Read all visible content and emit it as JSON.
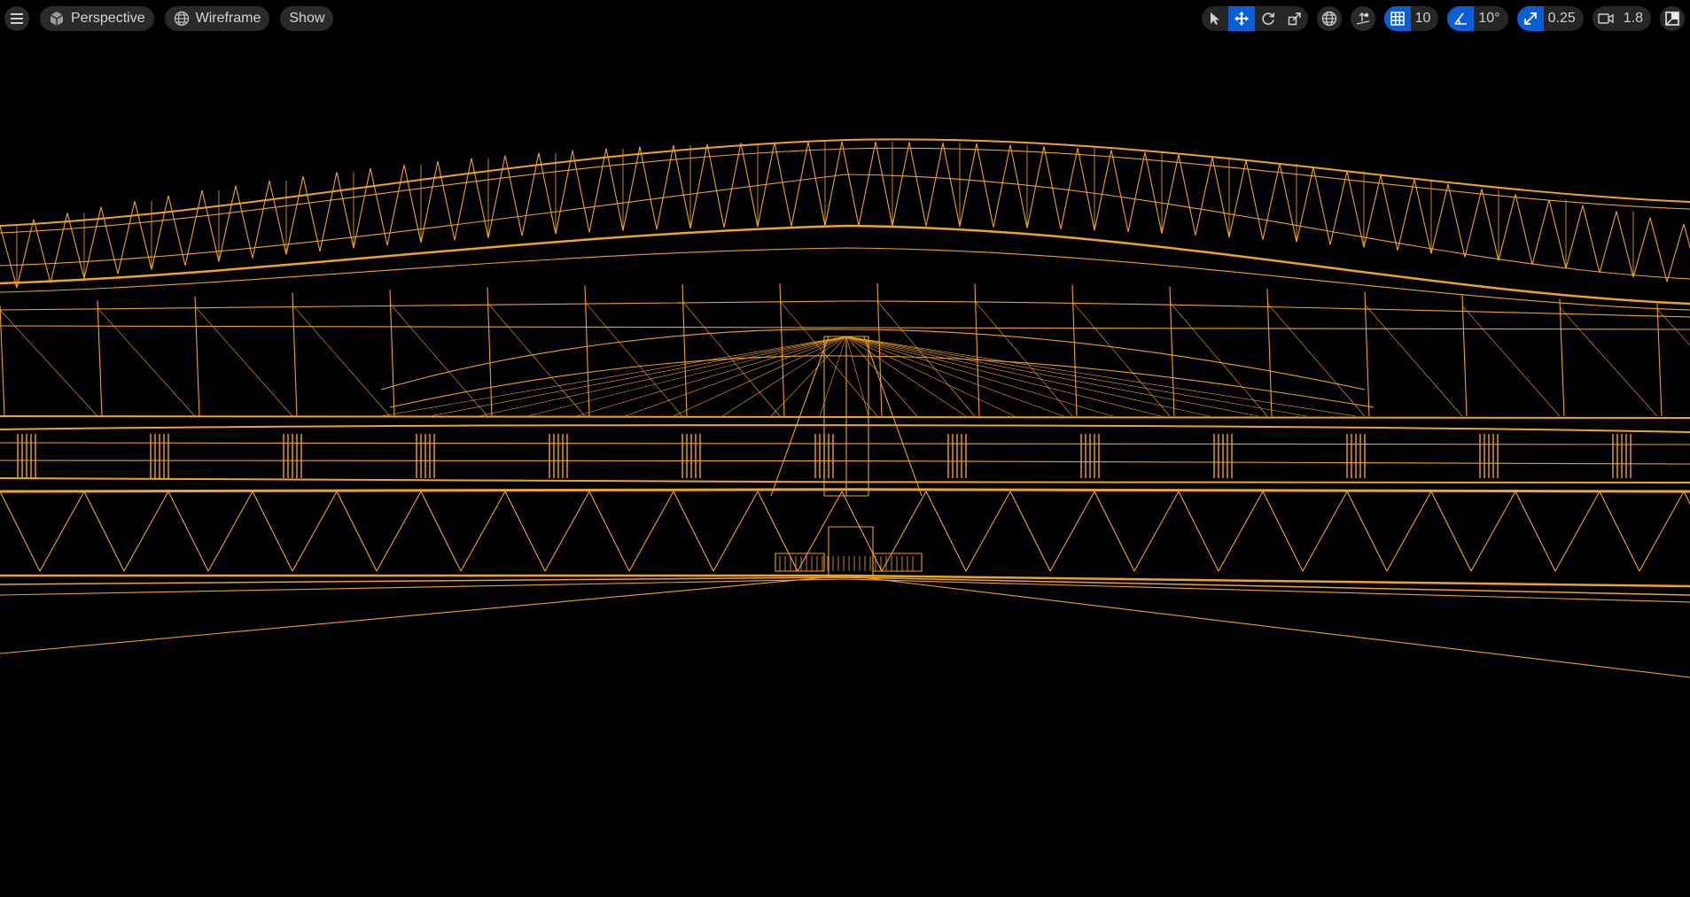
{
  "viewport": {
    "view_mode": "Perspective",
    "render_mode": "Wireframe",
    "show_label": "Show"
  },
  "toolbar": {
    "grid_snap_value": "10",
    "rotation_snap_value": "10°",
    "scale_snap_value": "0.25",
    "camera_speed_value": "1.8"
  },
  "icons": {
    "menu": "hamburger-menu-icon",
    "perspective": "cube-icon",
    "wireframe": "wireframe-sphere-icon",
    "select": "select-arrow-icon",
    "translate": "translate-move-icon",
    "rotate": "rotate-icon",
    "scale": "scale-icon",
    "world_local": "globe-icon",
    "surface_snap": "surface-snapping-icon",
    "grid_snap": "grid-icon",
    "rotation_snap": "angle-icon",
    "scale_snap": "scale-arrow-icon",
    "camera_speed": "camera-icon",
    "maximize": "maximize-viewport-icon"
  },
  "colors": {
    "background": "#000000",
    "wireframe": "#f0a51c",
    "accent": "#0a5fd6",
    "button_bg": "#2a2a2a",
    "text": "#d6d6d6"
  }
}
